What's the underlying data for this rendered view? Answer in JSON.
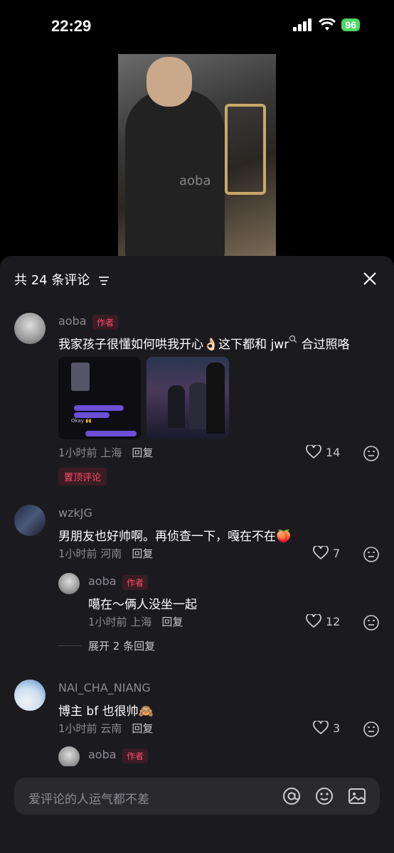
{
  "status": {
    "time": "22:29",
    "battery": "96"
  },
  "video": {
    "watermark": "aoba"
  },
  "header": {
    "count_label": "共 24 条评论"
  },
  "comments": [
    {
      "user": "aoba",
      "tag": "作者",
      "text": "我家孩子很懂如何哄我开心👌🏻这下都和 jwr",
      "text_suffix": " 合过照咯",
      "time": "1小时前 上海",
      "reply": "回复",
      "likes": "14",
      "pin": "置顶评论",
      "chat_text": "Okay 🙌"
    },
    {
      "user": "wzkJG",
      "text": "男朋友也好帅啊。再侦查一下，嘎在不在🍑",
      "time": "1小时前 河南",
      "reply": "回复",
      "likes": "7",
      "replies": [
        {
          "user": "aoba",
          "tag": "作者",
          "text": "噶在～俩人没坐一起",
          "time": "1小时前 上海",
          "reply": "回复",
          "likes": "12"
        }
      ],
      "expand": "展开 2 条回复"
    },
    {
      "user": "NAI_CHA_NIANG",
      "text": "博主 bf 也很帅🙈",
      "time": "1小时前 云南",
      "reply": "回复",
      "likes": "3",
      "replies": [
        {
          "user": "aoba",
          "tag": "作者"
        }
      ]
    }
  ],
  "input": {
    "placeholder": "爱评论的人运气都不差"
  }
}
